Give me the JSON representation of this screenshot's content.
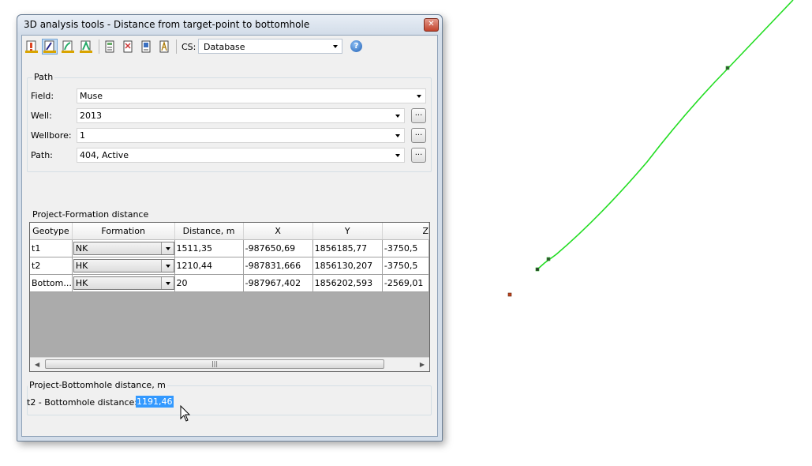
{
  "window": {
    "title": "3D analysis tools - Distance from target-point to bottomhole",
    "close_glyph": "✕"
  },
  "toolbar": {
    "icons": [
      "warning-well-icon",
      "well-select-icon",
      "well-path-icon",
      "well-multi-icon",
      "calc-table-icon",
      "calc-report-icon",
      "export-icon",
      "print-icon"
    ],
    "cs_label": "CS:",
    "cs_value": "Database",
    "help_glyph": "?"
  },
  "path_group": {
    "legend": "Path",
    "field_label": "Field:",
    "field_value": "Muse",
    "well_label": "Well:",
    "well_value": "2013",
    "wellbore_label": "Wellbore:",
    "wellbore_value": "1",
    "path_label": "Path:",
    "path_value": "404, Active",
    "browse_label": "..."
  },
  "formation_group": {
    "legend": "Project-Formation distance",
    "columns": [
      "Geotype",
      "Formation",
      "Distance, m",
      "X",
      "Y",
      "Z"
    ],
    "rows": [
      {
        "geotype": "t1",
        "formation": "NK",
        "distance": "1511,35",
        "x": "-987650,69",
        "y": "1856185,77",
        "z": "-3750,5"
      },
      {
        "geotype": "t2",
        "formation": "HK",
        "distance": "1210,44",
        "x": "-987831,666",
        "y": "1856130,207",
        "z": "-3750,5"
      },
      {
        "geotype": "Bottom...",
        "formation": "HK",
        "distance": "20",
        "x": "-987967,402",
        "y": "1856202,593",
        "z": "-2569,01"
      }
    ]
  },
  "bottomhole_group": {
    "legend": "Project-Bottomhole distance, m",
    "label": "t2 - Bottomhole distance:",
    "value": "1191,46"
  },
  "view3d": {
    "trajectory_color": "#22dd22",
    "marker_color": "#c0441c"
  }
}
